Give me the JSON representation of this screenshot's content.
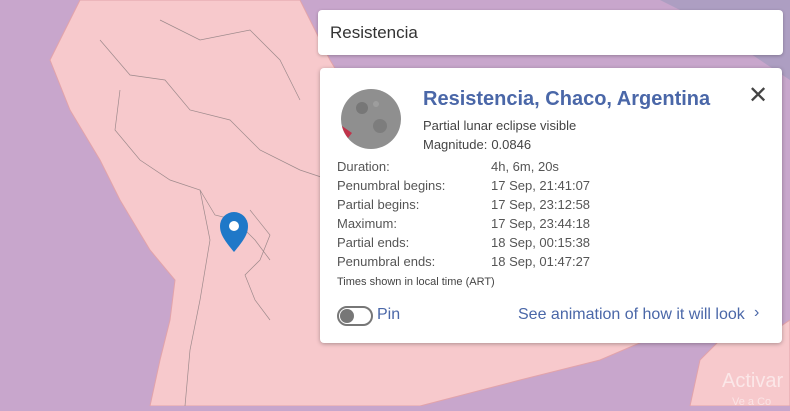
{
  "search": {
    "value": "Resistencia"
  },
  "card": {
    "title": "Resistencia, Chaco, Argentina",
    "subtitle": "Partial lunar eclipse visible",
    "magnitude_label": "Magnitude:",
    "magnitude_value": "0.0846",
    "details": [
      {
        "label": "Duration:",
        "value": "4h, 6m, 20s"
      },
      {
        "label": "Penumbral begins:",
        "value": "17 Sep, 21:41:07"
      },
      {
        "label": "Partial begins:",
        "value": "17 Sep, 23:12:58"
      },
      {
        "label": "Maximum:",
        "value": "17 Sep, 23:44:18"
      },
      {
        "label": "Partial ends:",
        "value": "18 Sep, 00:15:38"
      },
      {
        "label": "Penumbral ends:",
        "value": "18 Sep, 01:47:27"
      }
    ],
    "note": "Times shown in local time (ART)",
    "pin_label": "Pin",
    "pin_enabled": false,
    "animation_link": "See animation of how it will look",
    "close_icon": "close-icon"
  },
  "map": {
    "marker_icon": "map-pin-icon",
    "visible_zone_color": "#f7c9cc",
    "not_visible_color": "#c8a6cc",
    "watermark": "Activar",
    "watermark_sub": "Ve a Co"
  },
  "colors": {
    "accent": "#4a67a8",
    "marker": "#1f78c8"
  }
}
